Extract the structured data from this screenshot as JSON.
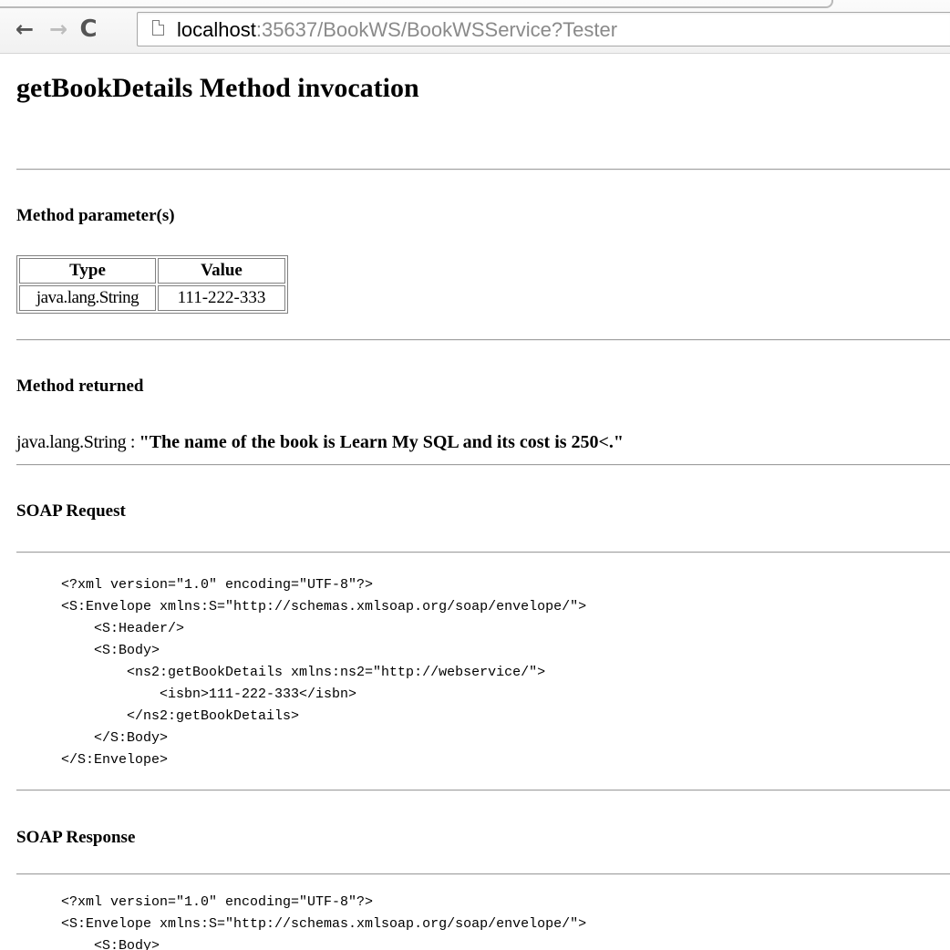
{
  "browser": {
    "back_glyph": "←",
    "forward_glyph": "→",
    "reload_glyph": "C",
    "url_host": "localhost",
    "url_path": ":35637/BookWS/BookWSService?Tester"
  },
  "page": {
    "title": "getBookDetails Method invocation",
    "parameters_heading": "Method parameter(s)",
    "parameters_table": {
      "headers": [
        "Type",
        "Value"
      ],
      "rows": [
        [
          "java.lang.String",
          "111-222-333"
        ]
      ]
    },
    "returned_heading": "Method returned",
    "returned_type": "java.lang.String : ",
    "returned_value": "\"The name of the book is Learn My SQL and its cost is 250<.\"",
    "soap_request_heading": "SOAP Request",
    "soap_request_xml": "<?xml version=\"1.0\" encoding=\"UTF-8\"?>\n<S:Envelope xmlns:S=\"http://schemas.xmlsoap.org/soap/envelope/\">\n    <S:Header/>\n    <S:Body>\n        <ns2:getBookDetails xmlns:ns2=\"http://webservice/\">\n            <isbn>111-222-333</isbn>\n        </ns2:getBookDetails>\n    </S:Body>\n</S:Envelope>",
    "soap_response_heading": "SOAP Response",
    "soap_response_xml": "<?xml version=\"1.0\" encoding=\"UTF-8\"?>\n<S:Envelope xmlns:S=\"http://schemas.xmlsoap.org/soap/envelope/\">\n    <S:Body>"
  }
}
